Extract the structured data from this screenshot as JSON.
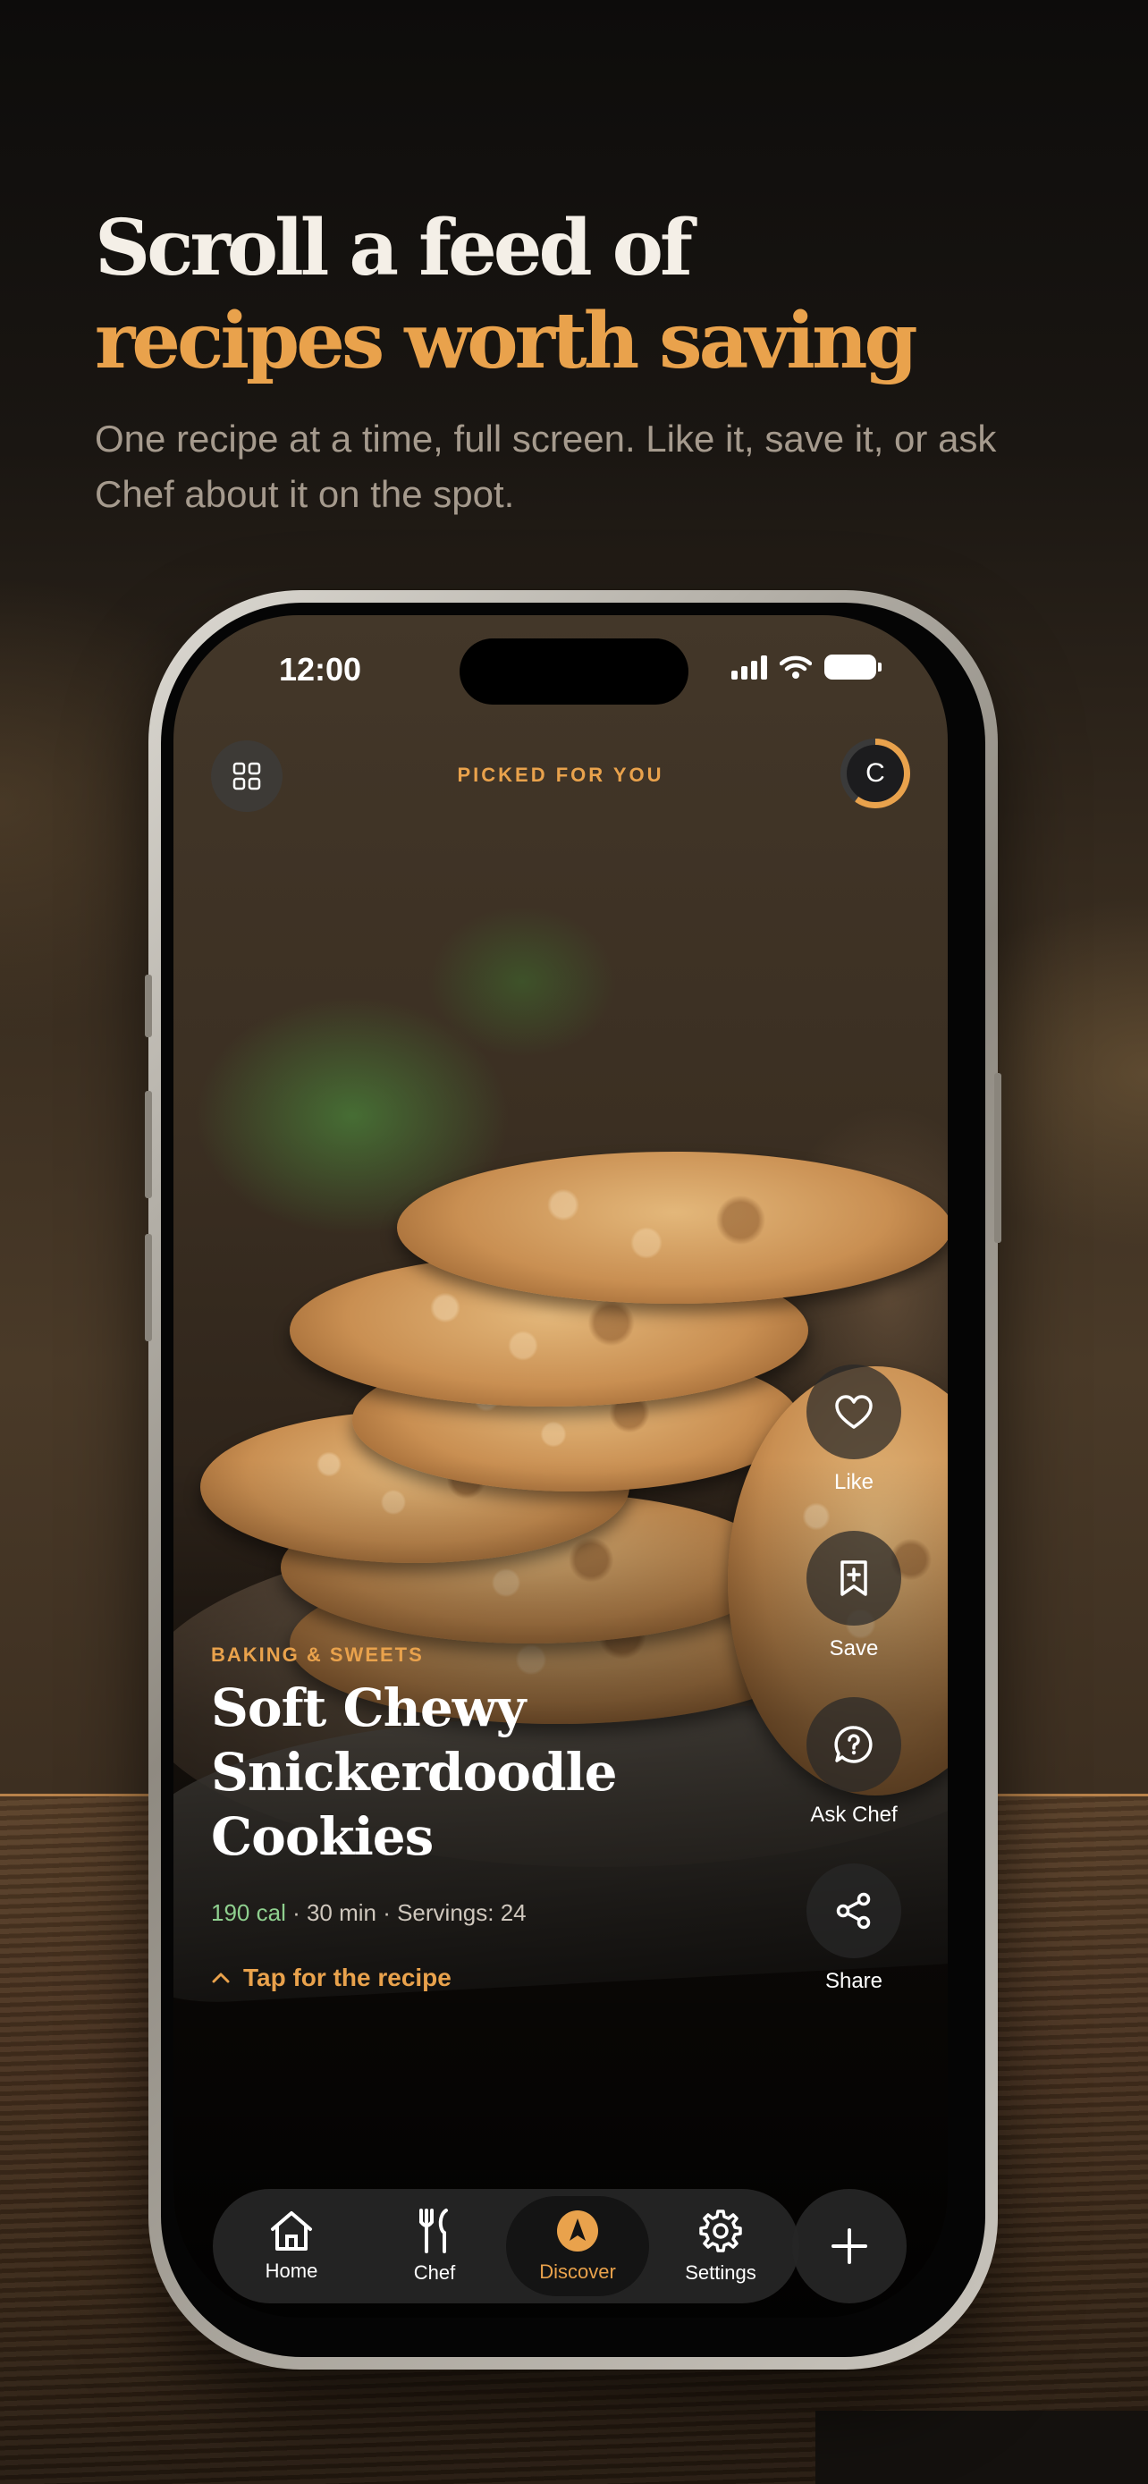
{
  "hero": {
    "line1": "Scroll a feed of",
    "line2": "recipes worth saving",
    "subtitle": "One recipe at a time, full screen. Like it, save it, or ask Chef about it on the spot."
  },
  "status": {
    "time": "12:00"
  },
  "header": {
    "label": "PICKED FOR YOU",
    "avatar_initial": "C"
  },
  "recipe": {
    "category": "BAKING & SWEETS",
    "title": "Soft Chewy Snickerdoodle Cookies",
    "calories": "190 cal",
    "details": " · 30 min · Servings: 24",
    "tap_label": "Tap for the recipe"
  },
  "actions": [
    {
      "label": "Like",
      "icon": "heart-icon"
    },
    {
      "label": "Save",
      "icon": "bookmark-plus-icon"
    },
    {
      "label": "Ask Chef",
      "icon": "question-bubble-icon"
    },
    {
      "label": "Share",
      "icon": "share-icon"
    }
  ],
  "tabs": [
    {
      "label": "Home",
      "icon": "home-icon"
    },
    {
      "label": "Chef",
      "icon": "fork-knife-icon"
    },
    {
      "label": "Discover",
      "icon": "compass-icon",
      "active": true
    },
    {
      "label": "Settings",
      "icon": "gear-icon"
    }
  ],
  "colors": {
    "accent": "#e9a24c",
    "calories": "#8fd08f"
  }
}
